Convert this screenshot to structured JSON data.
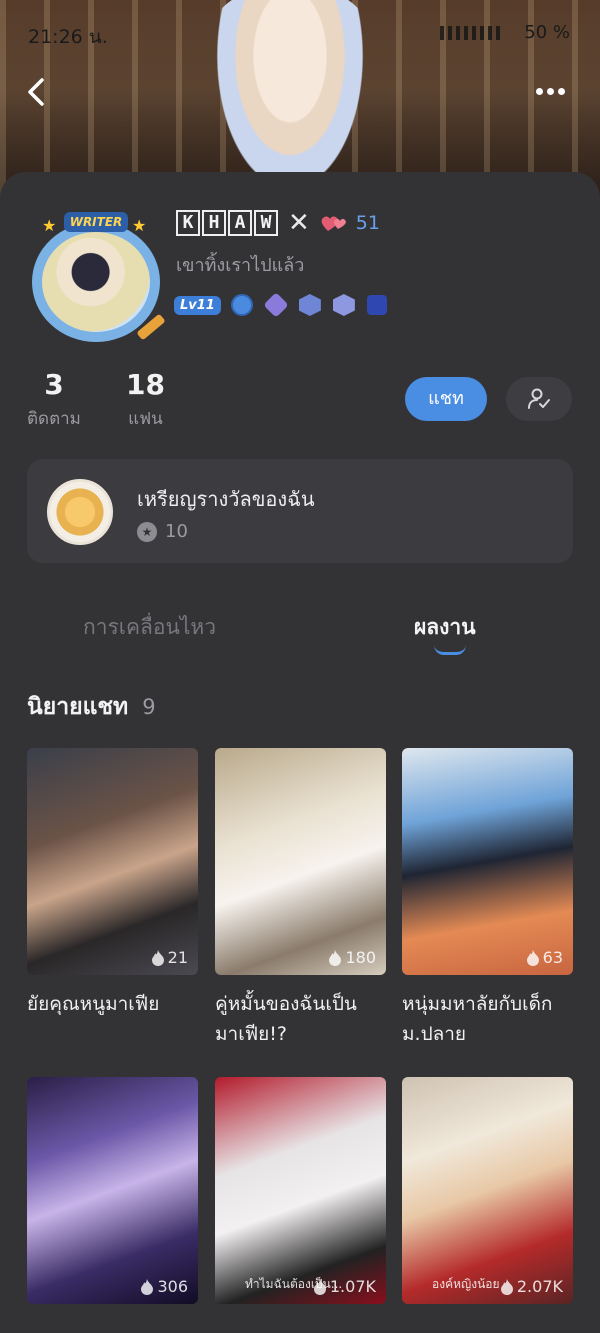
{
  "status_bar": {
    "time": "21:26 น.",
    "battery": "50 %"
  },
  "profile": {
    "badge_label": "WRITER",
    "name_letters": [
      "K",
      "H",
      "A",
      "W"
    ],
    "name_suffix": "✕",
    "likes": "51",
    "bio": "เขาทิ้งเราไปแล้ว",
    "level": "Lv11"
  },
  "stats": {
    "following": {
      "count": "3",
      "label": "ติดตาม"
    },
    "fans": {
      "count": "18",
      "label": "แฟน"
    }
  },
  "actions": {
    "chat_label": "แชท"
  },
  "medals": {
    "title": "เหรียญรางวัลของฉัน",
    "count": "10"
  },
  "tabs": [
    {
      "label": "การเคลื่อนไหว",
      "active": false
    },
    {
      "label": "ผลงาน",
      "active": true
    }
  ],
  "section": {
    "title": "นิยายแชท",
    "count": "9"
  },
  "novels": [
    {
      "title": "ยัยคุณหนูมาเฟีย",
      "views": "21"
    },
    {
      "title": "คู่หมั้นของฉันเป็นมาเฟีย!?",
      "views": "180"
    },
    {
      "title": "หนุ่มมหาลัยกับเด็กม.ปลาย",
      "views": "63"
    },
    {
      "title": "",
      "views": "306"
    },
    {
      "title": "",
      "views": "1.07K",
      "overlay": "ทำไมฉันต้องเป็น..."
    },
    {
      "title": "",
      "views": "2.07K",
      "overlay": "องค์หญิงน้อย"
    }
  ],
  "colors": {
    "accent": "#4a8ee4",
    "card_bg": "#333336",
    "page_bg": "#232326"
  }
}
